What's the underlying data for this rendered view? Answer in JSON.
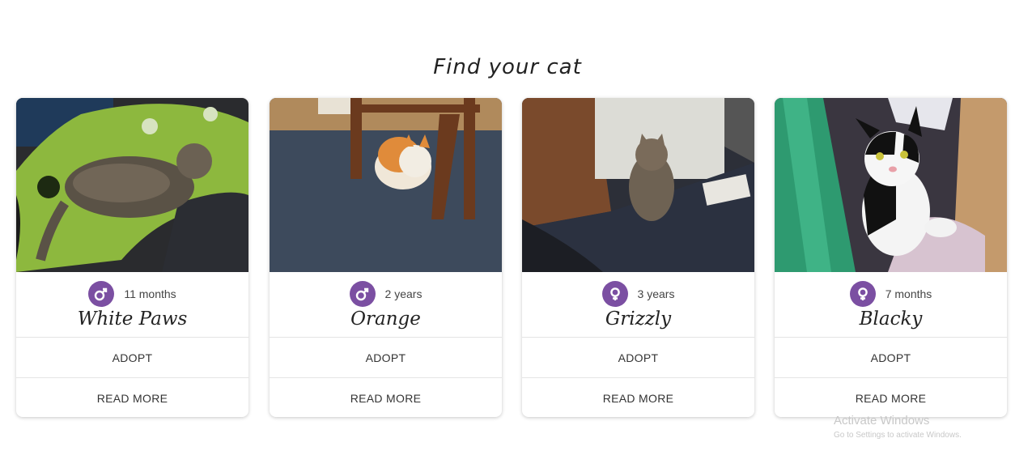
{
  "header": {
    "title": "Find your cat"
  },
  "accent_color": "#7b4fa2",
  "cats": [
    {
      "name": "White Paws",
      "age": "11 months",
      "gender_icon": "male-icon"
    },
    {
      "name": "Orange",
      "age": "2 years",
      "gender_icon": "male-icon"
    },
    {
      "name": "Grizzly",
      "age": "3 years",
      "gender_icon": "female-icon"
    },
    {
      "name": "Blacky",
      "age": "7 months",
      "gender_icon": "female-icon"
    }
  ],
  "actions": {
    "adopt_label": "ADOPT",
    "read_more_label": "READ MORE"
  },
  "watermark": {
    "title": "Activate Windows",
    "subtitle": "Go to Settings to activate Windows."
  }
}
